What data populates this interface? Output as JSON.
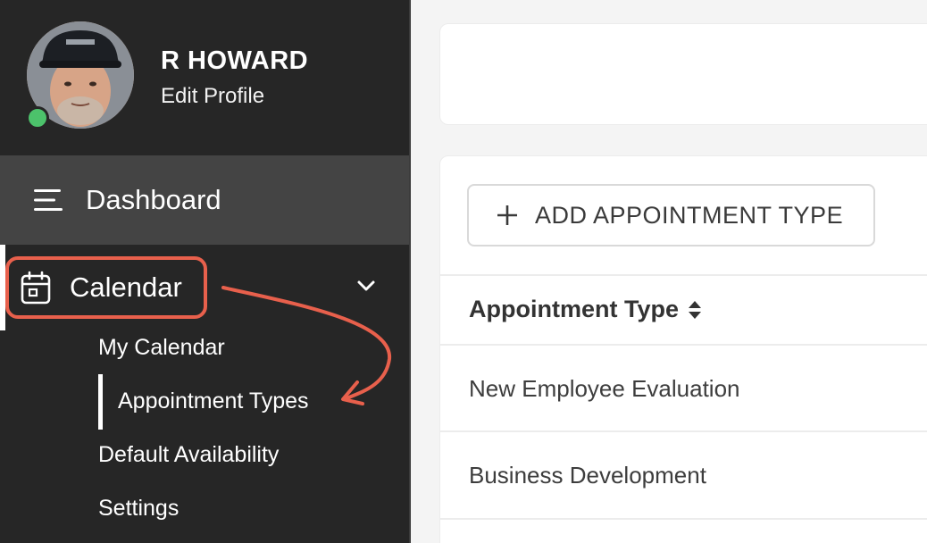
{
  "profile": {
    "name": "R HOWARD",
    "edit_label": "Edit Profile",
    "status": "online"
  },
  "nav": {
    "dashboard": {
      "label": "Dashboard",
      "icon": "menu-icon"
    },
    "calendar": {
      "label": "Calendar",
      "icon": "calendar-icon",
      "expanded": true,
      "sub_items": [
        {
          "label": "My Calendar"
        },
        {
          "label": "Appointment Types",
          "active": true
        },
        {
          "label": "Default Availability"
        },
        {
          "label": "Settings"
        }
      ]
    }
  },
  "main": {
    "add_button_label": "ADD APPOINTMENT TYPE",
    "table": {
      "column_header": "Appointment Type",
      "rows": [
        {
          "name": "New Employee Evaluation"
        },
        {
          "name": "Business Development"
        }
      ]
    }
  },
  "colors": {
    "sidebar_bg": "#262626",
    "active_nav_bg": "#444444",
    "annotation": "#e8604c",
    "online": "#4cc26b"
  }
}
